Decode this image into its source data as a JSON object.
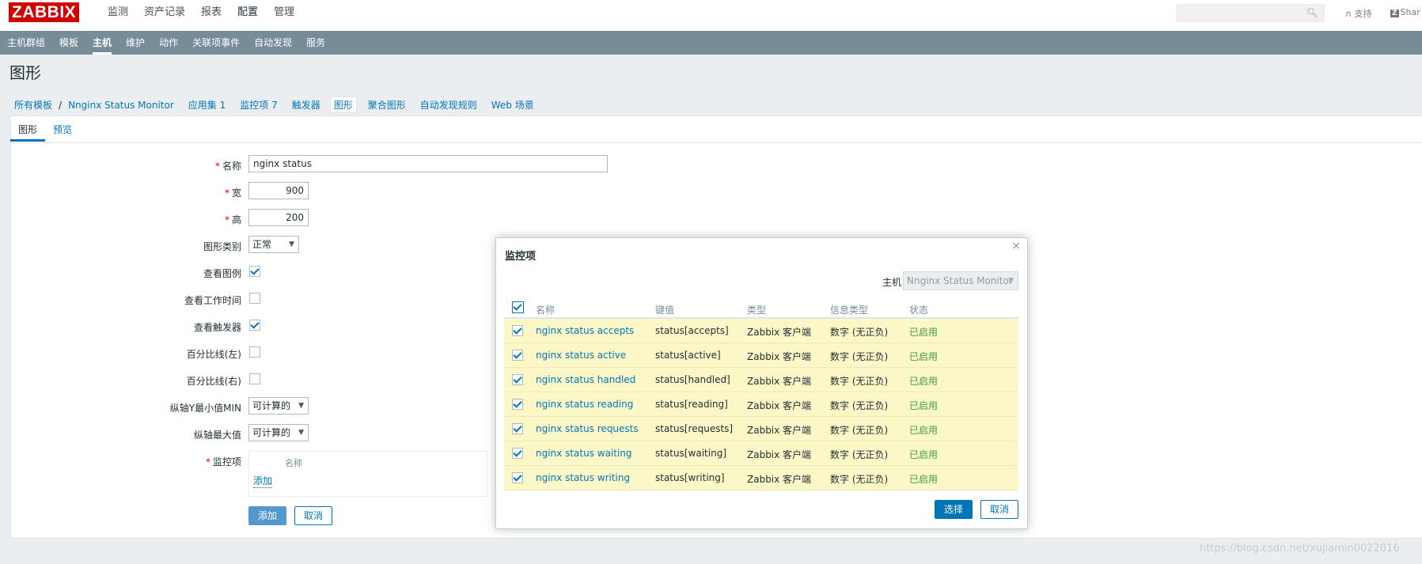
{
  "app": {
    "logo": "ZABBIX"
  },
  "main_menu": [
    {
      "label": "监测"
    },
    {
      "label": "资产记录"
    },
    {
      "label": "报表"
    },
    {
      "label": "配置",
      "active": true
    },
    {
      "label": "管理"
    }
  ],
  "top_right": {
    "search_placeholder": "",
    "support": "支持",
    "share": "Shar"
  },
  "sub_menu": [
    {
      "label": "主机群组"
    },
    {
      "label": "模板"
    },
    {
      "label": "主机",
      "active": true
    },
    {
      "label": "维护"
    },
    {
      "label": "动作"
    },
    {
      "label": "关联项事件"
    },
    {
      "label": "自动发现"
    },
    {
      "label": "服务"
    }
  ],
  "page_title": "图形",
  "breadcrumbs": {
    "all_templates": "所有模板",
    "separator": "/",
    "template": "Nnginx Status Monitor",
    "apps": "应用集 1",
    "items": "监控项 7",
    "triggers": "触发器",
    "graphs": "图形",
    "screens": "聚合图形",
    "discovery": "自动发现规则",
    "web": "Web 场景"
  },
  "tabs": {
    "graph": "图形",
    "preview": "预览"
  },
  "form": {
    "required_mark": "*",
    "name_label": "名称",
    "name_value": "nginx status",
    "width_label": "宽",
    "width_value": "900",
    "height_label": "高",
    "height_value": "200",
    "graph_type_label": "图形类别",
    "graph_type_value": "正常",
    "show_legend_label": "查看图例",
    "show_legend": true,
    "show_worktime_label": "查看工作时间",
    "show_worktime": false,
    "show_triggers_label": "查看触发器",
    "show_triggers": true,
    "percent_left_label": "百分比线(左)",
    "percent_left": false,
    "percent_right_label": "百分比线(右)",
    "percent_right": false,
    "ymin_label": "纵轴Y最小值MIN",
    "ymin_value": "可计算的",
    "ymax_label": "纵轴最大值",
    "ymax_value": "可计算的",
    "items_label": "监控项",
    "items_col_name": "名称",
    "items_add": "添加",
    "add_button": "添加",
    "cancel_button": "取消"
  },
  "modal": {
    "title": "监控项",
    "close": "×",
    "host_label": "主机",
    "host_value": "Nnginx Status Monitor",
    "columns": {
      "name": "名称",
      "key": "键值",
      "type": "类型",
      "info_type": "信息类型",
      "status": "状态"
    },
    "rows": [
      {
        "name": "nginx status accepts",
        "key": "status[accepts]",
        "type": "Zabbix 客户端",
        "info_type": "数字 (无正负)",
        "status": "已启用"
      },
      {
        "name": "nginx status active",
        "key": "status[active]",
        "type": "Zabbix 客户端",
        "info_type": "数字 (无正负)",
        "status": "已启用"
      },
      {
        "name": "nginx status handled",
        "key": "status[handled]",
        "type": "Zabbix 客户端",
        "info_type": "数字 (无正负)",
        "status": "已启用"
      },
      {
        "name": "nginx status reading",
        "key": "status[reading]",
        "type": "Zabbix 客户端",
        "info_type": "数字 (无正负)",
        "status": "已启用"
      },
      {
        "name": "nginx status requests",
        "key": "status[requests]",
        "type": "Zabbix 客户端",
        "info_type": "数字 (无正负)",
        "status": "已启用"
      },
      {
        "name": "nginx status waiting",
        "key": "status[waiting]",
        "type": "Zabbix 客户端",
        "info_type": "数字 (无正负)",
        "status": "已启用"
      },
      {
        "name": "nginx status writing",
        "key": "status[writing]",
        "type": "Zabbix 客户端",
        "info_type": "数字 (无正负)",
        "status": "已启用"
      }
    ],
    "select_button": "选择",
    "cancel_button": "取消"
  },
  "watermark": "https://blog.csdn.net/xujiamin0022016"
}
